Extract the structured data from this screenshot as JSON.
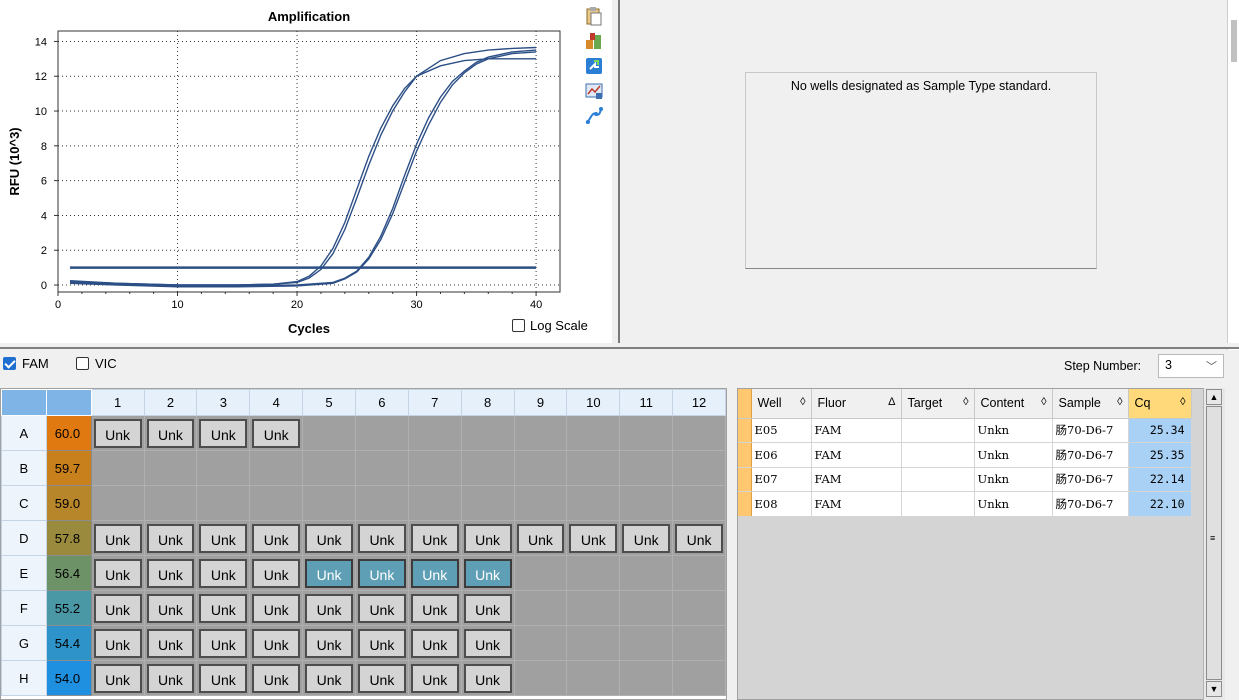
{
  "chart_data": {
    "type": "line",
    "title": "Amplification",
    "xlabel": "Cycles",
    "ylabel": "RFU (10^3)",
    "xlim": [
      0,
      42
    ],
    "ylim": [
      -0.4,
      14.6
    ],
    "x_ticks": [
      0,
      10,
      20,
      30,
      40
    ],
    "y_ticks": [
      0,
      2,
      4,
      6,
      8,
      10,
      12,
      14
    ],
    "grid": true,
    "threshold": 1.0,
    "line_color": "#2c4f86",
    "series": [
      {
        "points": [
          [
            1,
            0.2
          ],
          [
            5,
            0.1
          ],
          [
            10,
            0.0
          ],
          [
            15,
            0.0
          ],
          [
            18,
            0.05
          ],
          [
            20,
            0.15
          ],
          [
            21,
            0.4
          ],
          [
            22,
            0.9
          ],
          [
            23,
            1.8
          ],
          [
            24,
            3.2
          ],
          [
            25,
            5.0
          ],
          [
            26,
            6.9
          ],
          [
            27,
            8.6
          ],
          [
            28,
            10.0
          ],
          [
            29,
            11.1
          ],
          [
            30,
            12.0
          ],
          [
            32,
            12.9
          ],
          [
            34,
            13.3
          ],
          [
            36,
            13.5
          ],
          [
            38,
            13.6
          ],
          [
            40,
            13.65
          ]
        ]
      },
      {
        "points": [
          [
            1,
            0.25
          ],
          [
            5,
            0.1
          ],
          [
            10,
            0.0
          ],
          [
            15,
            0.0
          ],
          [
            18,
            0.05
          ],
          [
            20,
            0.2
          ],
          [
            21,
            0.5
          ],
          [
            22,
            1.1
          ],
          [
            23,
            2.1
          ],
          [
            24,
            3.6
          ],
          [
            25,
            5.5
          ],
          [
            26,
            7.4
          ],
          [
            27,
            9.0
          ],
          [
            28,
            10.3
          ],
          [
            29,
            11.3
          ],
          [
            30,
            12.0
          ],
          [
            32,
            12.6
          ],
          [
            34,
            12.9
          ],
          [
            36,
            13.0
          ],
          [
            38,
            13.0
          ],
          [
            40,
            13.0
          ]
        ]
      },
      {
        "points": [
          [
            1,
            0.15
          ],
          [
            5,
            0.05
          ],
          [
            10,
            -0.05
          ],
          [
            15,
            -0.05
          ],
          [
            20,
            0.0
          ],
          [
            23,
            0.15
          ],
          [
            24,
            0.4
          ],
          [
            25,
            0.8
          ],
          [
            26,
            1.6
          ],
          [
            27,
            2.8
          ],
          [
            28,
            4.4
          ],
          [
            29,
            6.3
          ],
          [
            30,
            8.1
          ],
          [
            31,
            9.6
          ],
          [
            32,
            10.8
          ],
          [
            33,
            11.7
          ],
          [
            34,
            12.3
          ],
          [
            35,
            12.8
          ],
          [
            36,
            13.1
          ],
          [
            38,
            13.4
          ],
          [
            40,
            13.5
          ]
        ]
      },
      {
        "points": [
          [
            1,
            0.1
          ],
          [
            5,
            0.0
          ],
          [
            10,
            -0.1
          ],
          [
            15,
            -0.1
          ],
          [
            20,
            -0.05
          ],
          [
            23,
            0.1
          ],
          [
            24,
            0.35
          ],
          [
            25,
            0.75
          ],
          [
            26,
            1.5
          ],
          [
            27,
            2.6
          ],
          [
            28,
            4.1
          ],
          [
            29,
            5.9
          ],
          [
            30,
            7.7
          ],
          [
            31,
            9.2
          ],
          [
            32,
            10.5
          ],
          [
            33,
            11.5
          ],
          [
            34,
            12.2
          ],
          [
            35,
            12.7
          ],
          [
            36,
            13.0
          ],
          [
            38,
            13.3
          ],
          [
            40,
            13.4
          ]
        ]
      }
    ]
  },
  "chart_panel": {
    "log_scale_label": "Log Scale",
    "icons": [
      "clipboard-copy-icon",
      "export-chart-icon",
      "refresh-icon",
      "chart-settings-icon",
      "curve-fit-icon"
    ]
  },
  "standard_curve": {
    "message": "No wells designated as Sample Type standard."
  },
  "fluor_bar": {
    "fam_label": "FAM",
    "fam_checked": true,
    "vic_label": "VIC",
    "vic_checked": false,
    "step_label": "Step Number:",
    "step_value": "3"
  },
  "plate": {
    "columns": [
      "1",
      "2",
      "3",
      "4",
      "5",
      "6",
      "7",
      "8",
      "9",
      "10",
      "11",
      "12"
    ],
    "rows": [
      {
        "label": "A",
        "temp": "60.0",
        "temp_color": "#e07a10",
        "wells": [
          "Unk",
          "Unk",
          "Unk",
          "Unk",
          "",
          "",
          "",
          "",
          "",
          "",
          "",
          ""
        ],
        "selected": []
      },
      {
        "label": "B",
        "temp": "59.7",
        "temp_color": "#c8801c",
        "wells": [
          "",
          "",
          "",
          "",
          "",
          "",
          "",
          "",
          "",
          "",
          "",
          ""
        ],
        "selected": []
      },
      {
        "label": "C",
        "temp": "59.0",
        "temp_color": "#b8862a",
        "wells": [
          "",
          "",
          "",
          "",
          "",
          "",
          "",
          "",
          "",
          "",
          "",
          ""
        ],
        "selected": []
      },
      {
        "label": "D",
        "temp": "57.8",
        "temp_color": "#9a8a3e",
        "wells": [
          "Unk",
          "Unk",
          "Unk",
          "Unk",
          "Unk",
          "Unk",
          "Unk",
          "Unk",
          "Unk",
          "Unk",
          "Unk",
          "Unk"
        ],
        "selected": []
      },
      {
        "label": "E",
        "temp": "56.4",
        "temp_color": "#6e9268",
        "wells": [
          "Unk",
          "Unk",
          "Unk",
          "Unk",
          "Unk",
          "Unk",
          "Unk",
          "Unk",
          "",
          "",
          "",
          ""
        ],
        "selected": [
          4,
          5,
          6,
          7
        ]
      },
      {
        "label": "F",
        "temp": "55.2",
        "temp_color": "#4a97a6",
        "wells": [
          "Unk",
          "Unk",
          "Unk",
          "Unk",
          "Unk",
          "Unk",
          "Unk",
          "Unk",
          "",
          "",
          "",
          ""
        ],
        "selected": []
      },
      {
        "label": "G",
        "temp": "54.4",
        "temp_color": "#2e93c8",
        "wells": [
          "Unk",
          "Unk",
          "Unk",
          "Unk",
          "Unk",
          "Unk",
          "Unk",
          "Unk",
          "",
          "",
          "",
          ""
        ],
        "selected": []
      },
      {
        "label": "H",
        "temp": "54.0",
        "temp_color": "#1f8fe0",
        "wells": [
          "Unk",
          "Unk",
          "Unk",
          "Unk",
          "Unk",
          "Unk",
          "Unk",
          "Unk",
          "",
          "",
          "",
          ""
        ],
        "selected": []
      }
    ]
  },
  "results_table": {
    "headers": [
      {
        "label": "Well",
        "sort": "◊"
      },
      {
        "label": "Fluor",
        "sort": "Δ"
      },
      {
        "label": "Target",
        "sort": "◊"
      },
      {
        "label": "Content",
        "sort": "◊"
      },
      {
        "label": "Sample",
        "sort": "◊"
      },
      {
        "label": "Cq",
        "sort": "◊"
      }
    ],
    "rows": [
      {
        "well": "E05",
        "fluor": "FAM",
        "target": "",
        "content": "Unkn",
        "sample": "肠70-D6-7",
        "cq": "25.34"
      },
      {
        "well": "E06",
        "fluor": "FAM",
        "target": "",
        "content": "Unkn",
        "sample": "肠70-D6-7",
        "cq": "25.35"
      },
      {
        "well": "E07",
        "fluor": "FAM",
        "target": "",
        "content": "Unkn",
        "sample": "肠70-D6-7",
        "cq": "22.14"
      },
      {
        "well": "E08",
        "fluor": "FAM",
        "target": "",
        "content": "Unkn",
        "sample": "肠70-D6-7",
        "cq": "22.10"
      }
    ]
  }
}
